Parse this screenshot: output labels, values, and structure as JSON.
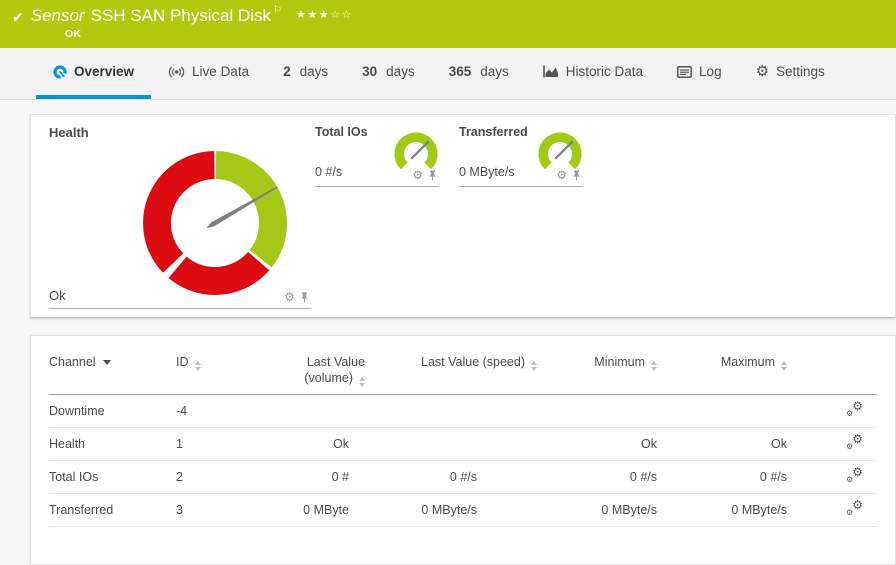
{
  "colors": {
    "header_green": "#b2c90e",
    "gauge_green": "#a5c716",
    "gauge_red": "#dc0b12",
    "needle_gray": "#7f7f7f",
    "accent_blue": "#0d93cc"
  },
  "header": {
    "type_label": "Sensor",
    "sensor_name": "SSH SAN Physical Disk",
    "status": "OK",
    "rating_filled": 3,
    "rating_total": 5
  },
  "tabs": [
    {
      "label": "Overview",
      "active": true
    },
    {
      "label": "Live Data"
    },
    {
      "num": "2",
      "label": "days"
    },
    {
      "num": "30",
      "label": "days"
    },
    {
      "num": "365",
      "label": "days"
    },
    {
      "label": "Historic Data"
    },
    {
      "label": "Log"
    },
    {
      "label": "Settings"
    }
  ],
  "gauges": {
    "health": {
      "title": "Health",
      "status_label": "Ok",
      "needle_deg": 60,
      "segments": [
        {
          "from": 1,
          "to": 128,
          "color": "#a5c716"
        },
        {
          "from": 131,
          "to": 220,
          "color": "#dc0b12"
        },
        {
          "from": 226,
          "to": 359,
          "color": "#dc0b12"
        }
      ]
    },
    "minis": [
      {
        "title": "Total IOs",
        "value": "0 #/s",
        "needle_deg": 45
      },
      {
        "title": "Transferred",
        "value": "0 MByte/s",
        "needle_deg": 45
      }
    ]
  },
  "table": {
    "columns": {
      "channel": "Channel",
      "id": "ID",
      "volume_line1": "Last Value",
      "volume_line2": "(volume)",
      "speed": "Last Value (speed)",
      "min": "Minimum",
      "max": "Maximum"
    },
    "rows": [
      {
        "channel": "Downtime",
        "id": "-4",
        "volume": "",
        "speed": "",
        "min": "",
        "max": ""
      },
      {
        "channel": "Health",
        "id": "1",
        "volume": "Ok",
        "speed": "",
        "min": "Ok",
        "max": "Ok"
      },
      {
        "channel": "Total IOs",
        "id": "2",
        "volume": "0 #",
        "speed": "0 #/s",
        "min": "0 #/s",
        "max": "0 #/s"
      },
      {
        "channel": "Transferred",
        "id": "3",
        "volume": "0 MByte",
        "speed": "0 MByte/s",
        "min": "0 MByte/s",
        "max": "0 MByte/s"
      }
    ]
  }
}
